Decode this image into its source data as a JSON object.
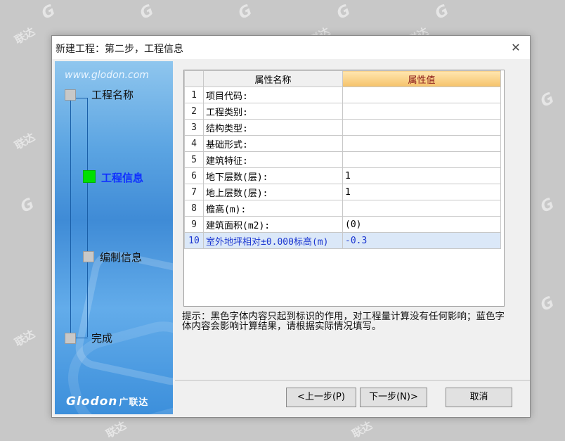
{
  "background_watermarks": [
    "联达",
    "G"
  ],
  "dialog": {
    "title": "新建工程：第二步，工程信息",
    "close_glyph": "✕"
  },
  "sidebar": {
    "site": "www.glodon.com",
    "steps": [
      {
        "label": "工程名称",
        "state": "done"
      },
      {
        "label": "工程信息",
        "state": "active"
      },
      {
        "label": "编制信息",
        "state": "pending"
      },
      {
        "label": "完成",
        "state": "pending"
      }
    ],
    "logo": "Glodon",
    "logo_cn": "广联达"
  },
  "grid": {
    "headers": [
      "属性名称",
      "属性值"
    ],
    "rows": [
      {
        "num": "1",
        "name": "项目代码:",
        "value": ""
      },
      {
        "num": "2",
        "name": "工程类别:",
        "value": ""
      },
      {
        "num": "3",
        "name": "结构类型:",
        "value": ""
      },
      {
        "num": "4",
        "name": "基础形式:",
        "value": ""
      },
      {
        "num": "5",
        "name": "建筑特征:",
        "value": ""
      },
      {
        "num": "6",
        "name": "地下层数(层):",
        "value": "1"
      },
      {
        "num": "7",
        "name": "地上层数(层):",
        "value": "1"
      },
      {
        "num": "8",
        "name": "檐高(m):",
        "value": ""
      },
      {
        "num": "9",
        "name": "建筑面积(m2):",
        "value": "(0)"
      },
      {
        "num": "10",
        "name": "室外地坪相对±0.000标高(m)",
        "value": "-0.3"
      }
    ],
    "selected_row": 10
  },
  "hint": "提示：黑色字体内容只起到标识的作用，对工程量计算没有任何影响；蓝色字体内容会影响计算结果，请根据实际情况填写。",
  "buttons": {
    "prev": "<上一步(P)",
    "next": "下一步(N)>",
    "cancel": "取消"
  },
  "colors": {
    "active_step": "#00e000",
    "selected_row_bg": "#dbe8f8",
    "blue_text": "#1a35d0",
    "header_value_bg": "#f5c26a"
  }
}
